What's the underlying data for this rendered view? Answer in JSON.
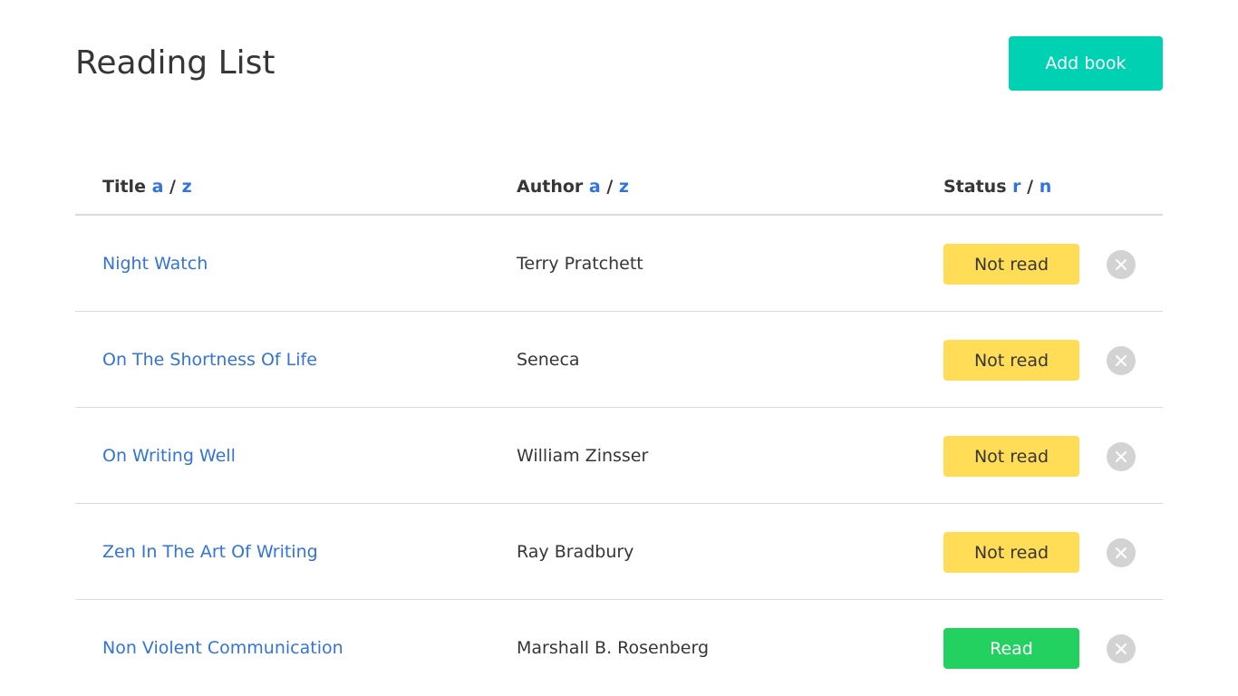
{
  "header": {
    "title": "Reading List",
    "add_button_label": "Add book"
  },
  "table": {
    "columns": {
      "title": {
        "label": "Title",
        "sort_asc": "a",
        "sep": "/",
        "sort_desc": "z"
      },
      "author": {
        "label": "Author",
        "sort_asc": "a",
        "sep": "/",
        "sort_desc": "z"
      },
      "status": {
        "label": "Status",
        "sort_asc": "r",
        "sep": "/",
        "sort_desc": "n"
      }
    },
    "rows": [
      {
        "title": "Night Watch",
        "author": "Terry Pratchett",
        "status": "Not read",
        "read": false
      },
      {
        "title": "On The Shortness Of Life",
        "author": "Seneca",
        "status": "Not read",
        "read": false
      },
      {
        "title": "On Writing Well",
        "author": "William Zinsser",
        "status": "Not read",
        "read": false
      },
      {
        "title": "Zen In The Art Of Writing",
        "author": "Ray Bradbury",
        "status": "Not read",
        "read": false
      },
      {
        "title": "Non Violent Communication",
        "author": "Marshall B. Rosenberg",
        "status": "Read",
        "read": true
      }
    ]
  },
  "icons": {
    "delete": "close-icon"
  },
  "colors": {
    "primary": "#00d1b2",
    "link": "#3273dc",
    "not_read": "#ffdd57",
    "read": "#23d160",
    "delete": "#d3d3d3"
  }
}
